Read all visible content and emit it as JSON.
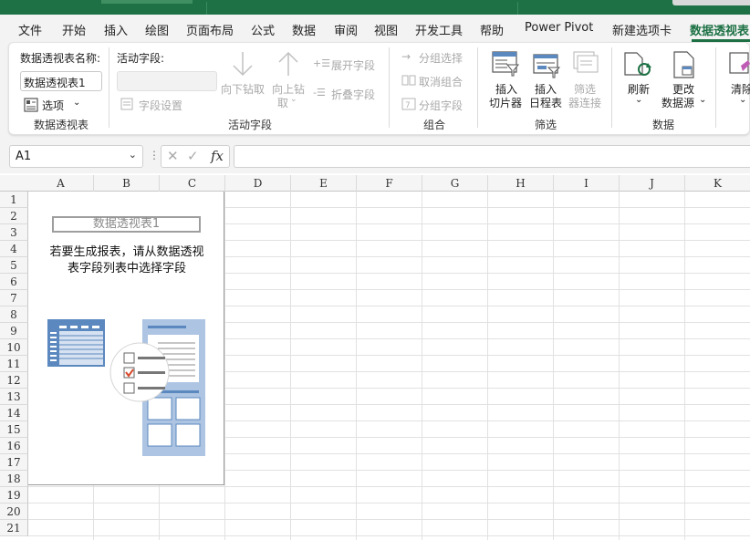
{
  "tabs": [
    "文件",
    "开始",
    "插入",
    "绘图",
    "页面布局",
    "公式",
    "数据",
    "审阅",
    "视图",
    "开发工具",
    "帮助",
    "Power Pivot",
    "新建选项卡",
    "数据透视表"
  ],
  "active_tab": "数据透视表",
  "ribbon": {
    "pivot_table": {
      "name_label": "数据透视表名称:",
      "name_value": "数据透视表1",
      "options_label": "选项",
      "group_label": "数据透视表"
    },
    "active_field": {
      "field_label": "活动字段:",
      "field_settings": "字段设置",
      "drill_down_line1": "向下钻取",
      "drill_up_line1": "向上钻",
      "drill_up_line2": "取",
      "expand_field": "展开字段",
      "collapse_field": "折叠字段",
      "group_label": "活动字段"
    },
    "group": {
      "group_selection": "分组选择",
      "ungroup": "取消组合",
      "group_field": "分组字段",
      "group_label": "组合"
    },
    "filter": {
      "insert_slicer_line1": "插入",
      "insert_slicer_line2": "切片器",
      "insert_timeline_line1": "插入",
      "insert_timeline_line2": "日程表",
      "filter_conn_line1": "筛选",
      "filter_conn_line2": "器连接",
      "group_label": "筛选"
    },
    "data": {
      "refresh": "刷新",
      "change_source_line1": "更改",
      "change_source_line2": "数据源",
      "group_label": "数据"
    },
    "clear": {
      "clear_label": "清除"
    }
  },
  "formula_bar": {
    "name_box": "A1",
    "fx_label": "fx",
    "formula": ""
  },
  "columns": [
    "A",
    "B",
    "C",
    "D",
    "E",
    "F",
    "G",
    "H",
    "I",
    "J",
    "K"
  ],
  "rows": [
    "1",
    "2",
    "3",
    "4",
    "5",
    "6",
    "7",
    "8",
    "9",
    "10",
    "11",
    "12",
    "13",
    "14",
    "15",
    "16",
    "17",
    "18",
    "19",
    "20",
    "21"
  ],
  "pivot_placeholder": {
    "name": "数据透视表1",
    "instruction_line1": "若要生成报表，请从数据透视",
    "instruction_line2": "表字段列表中选择字段"
  },
  "colors": {
    "accent": "#1e7145",
    "illustration_blue": "#5b88bf"
  }
}
